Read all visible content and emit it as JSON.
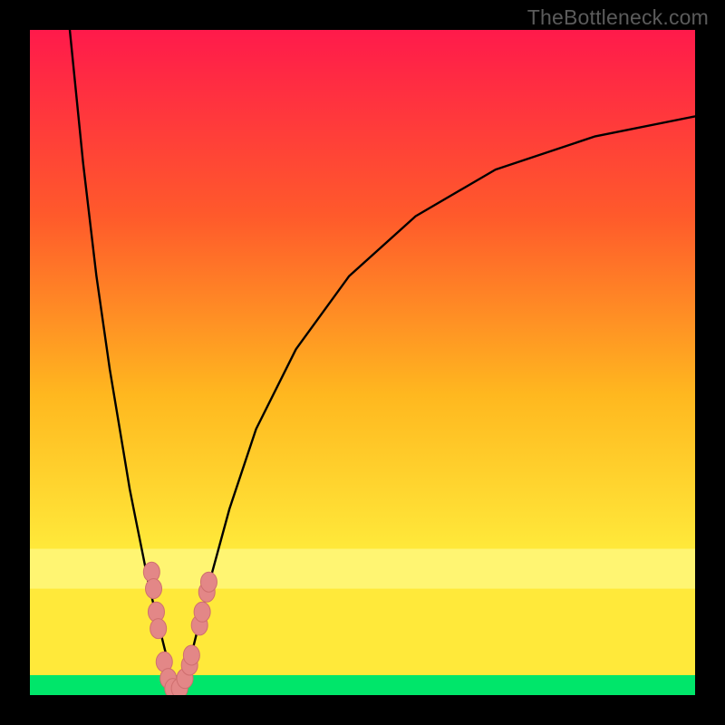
{
  "watermark": "TheBottleneck.com",
  "colors": {
    "top": "#ff1a4b",
    "upper_mid": "#ff5a2b",
    "mid": "#ffb81f",
    "lower_mid": "#ffe93a",
    "pale_band": "#ffffa0",
    "green": "#00e66a",
    "curve": "#000000",
    "dot_fill": "#e38787",
    "dot_stroke": "#cf6f6f"
  },
  "chart_data": {
    "type": "line",
    "title": "",
    "xlabel": "",
    "ylabel": "",
    "xlim": [
      0,
      100
    ],
    "ylim": [
      0,
      100
    ],
    "series": [
      {
        "name": "left-branch",
        "x": [
          6,
          8,
          10,
          12,
          14,
          15,
          16,
          17,
          18,
          19,
          20,
          21,
          21.8
        ],
        "y": [
          100,
          80,
          63,
          49,
          37,
          31,
          26,
          21,
          16,
          12,
          8,
          4,
          1
        ]
      },
      {
        "name": "right-branch",
        "x": [
          22,
          23,
          24,
          25,
          27,
          30,
          34,
          40,
          48,
          58,
          70,
          85,
          100
        ],
        "y": [
          0,
          2,
          5,
          9,
          17,
          28,
          40,
          52,
          63,
          72,
          79,
          84,
          87
        ]
      }
    ],
    "scatter": {
      "name": "sample-dots",
      "points": [
        {
          "x": 18.3,
          "y": 18.5
        },
        {
          "x": 18.6,
          "y": 16.0
        },
        {
          "x": 19.0,
          "y": 12.5
        },
        {
          "x": 19.3,
          "y": 10.0
        },
        {
          "x": 20.2,
          "y": 5.0
        },
        {
          "x": 20.8,
          "y": 2.5
        },
        {
          "x": 21.5,
          "y": 1.0
        },
        {
          "x": 22.5,
          "y": 1.0
        },
        {
          "x": 23.3,
          "y": 2.5
        },
        {
          "x": 24.0,
          "y": 4.5
        },
        {
          "x": 24.3,
          "y": 6.0
        },
        {
          "x": 25.5,
          "y": 10.5
        },
        {
          "x": 25.9,
          "y": 12.5
        },
        {
          "x": 26.6,
          "y": 15.5
        },
        {
          "x": 26.9,
          "y": 17.0
        }
      ]
    },
    "bands": [
      {
        "name": "pale-yellow",
        "y0": 16,
        "y1": 22
      },
      {
        "name": "green",
        "y0": 0,
        "y1": 3
      }
    ]
  }
}
